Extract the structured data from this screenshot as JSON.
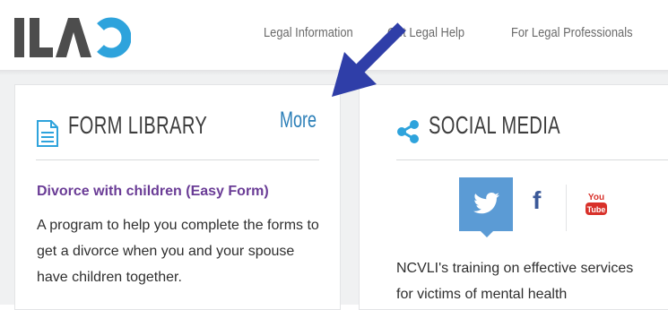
{
  "header": {
    "logo_text": "ILAO",
    "nav": [
      {
        "label": "Legal Information"
      },
      {
        "label": "Get Legal Help"
      },
      {
        "label": "For Legal Professionals"
      }
    ]
  },
  "form_library": {
    "title": "FORM LIBRARY",
    "more_label": "More",
    "link_label": "Divorce with children (Easy Form)",
    "description": "A program to help you complete the forms to get a divorce when you and your spouse have children together."
  },
  "social_media": {
    "title": "SOCIAL MEDIA",
    "active_network": "twitter",
    "networks": [
      "twitter",
      "facebook",
      "youtube"
    ],
    "description_line1": "NCVLI's training on effective services",
    "description_line2": "for victims of mental health"
  },
  "colors": {
    "logo_gray": "#4d4d4d",
    "logo_blue": "#2ea3dc",
    "link_purple": "#6a3c96",
    "more_blue": "#2c7fb8",
    "twitter_blue": "#5b9bd5",
    "facebook_blue": "#3b5998",
    "youtube_red": "#d8312a",
    "arrow_blue": "#2f3ea8"
  }
}
